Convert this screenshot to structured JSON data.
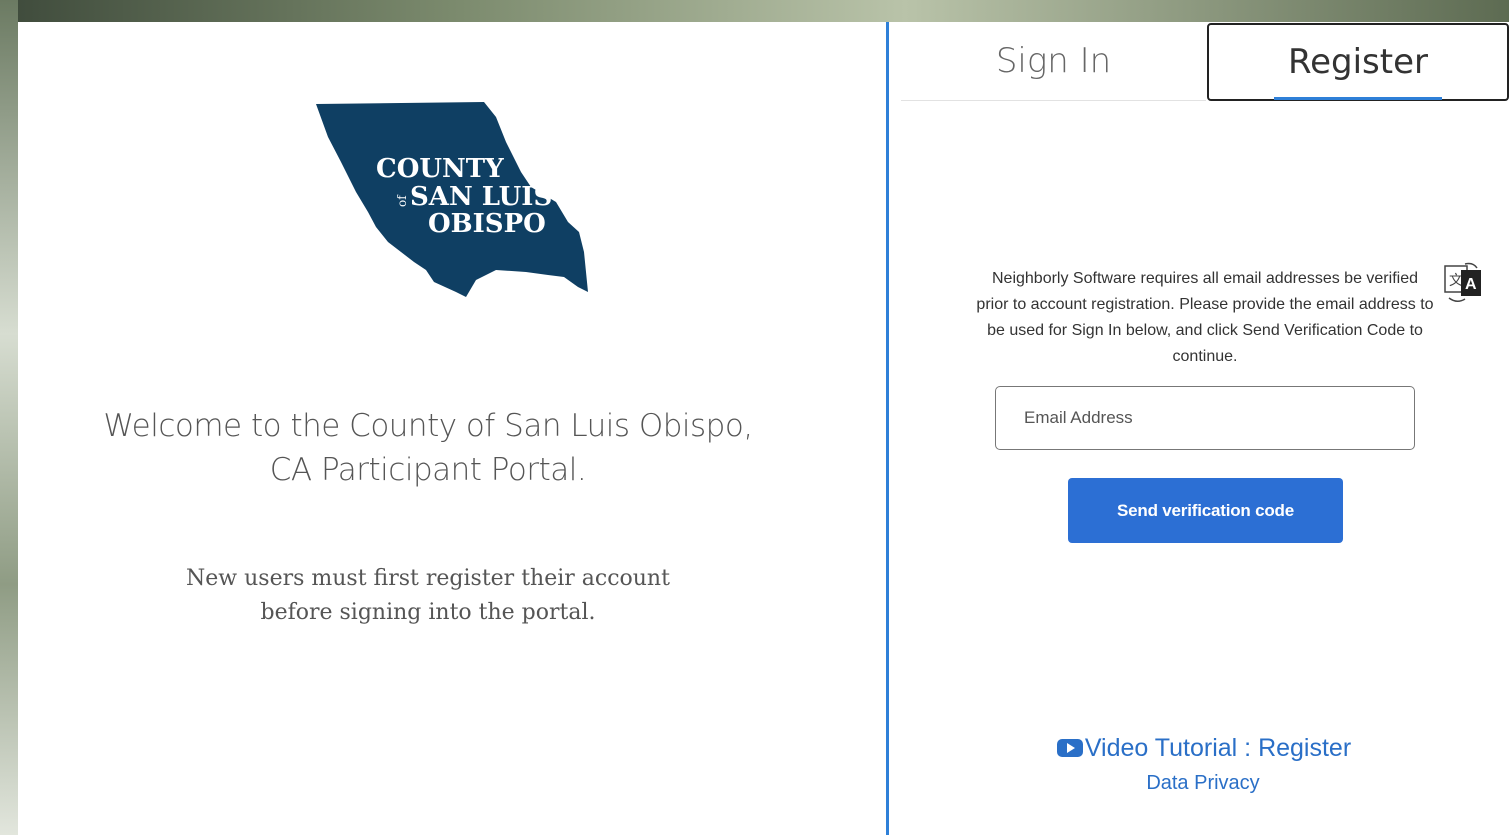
{
  "logo": {
    "line1": "COUNTY",
    "of": "of",
    "line2": "SAN LUIS",
    "line3": "OBISPO",
    "color": "#0f3f63"
  },
  "left": {
    "welcome": "Welcome to the County of San Luis Obispo, CA Participant Portal.",
    "new_users": "New users must first register their account before signing into the portal."
  },
  "tabs": {
    "signin": "Sign In",
    "register": "Register",
    "active": "register"
  },
  "form": {
    "instructions": "Neighborly Software requires all email addresses be verified prior to account registration. Please provide the email address to be used for Sign In below, and click Send Verification Code to continue.",
    "email_placeholder": "Email Address",
    "email_value": "",
    "send_button": "Send verification code"
  },
  "footer": {
    "video_tutorial": "Video Tutorial : Register",
    "data_privacy": "Data Privacy"
  },
  "colors": {
    "accent": "#2f80d8",
    "button": "#2c6fd4",
    "link": "#2a6fc7"
  },
  "icons": {
    "translate": "translate-icon",
    "video": "youtube-icon"
  }
}
